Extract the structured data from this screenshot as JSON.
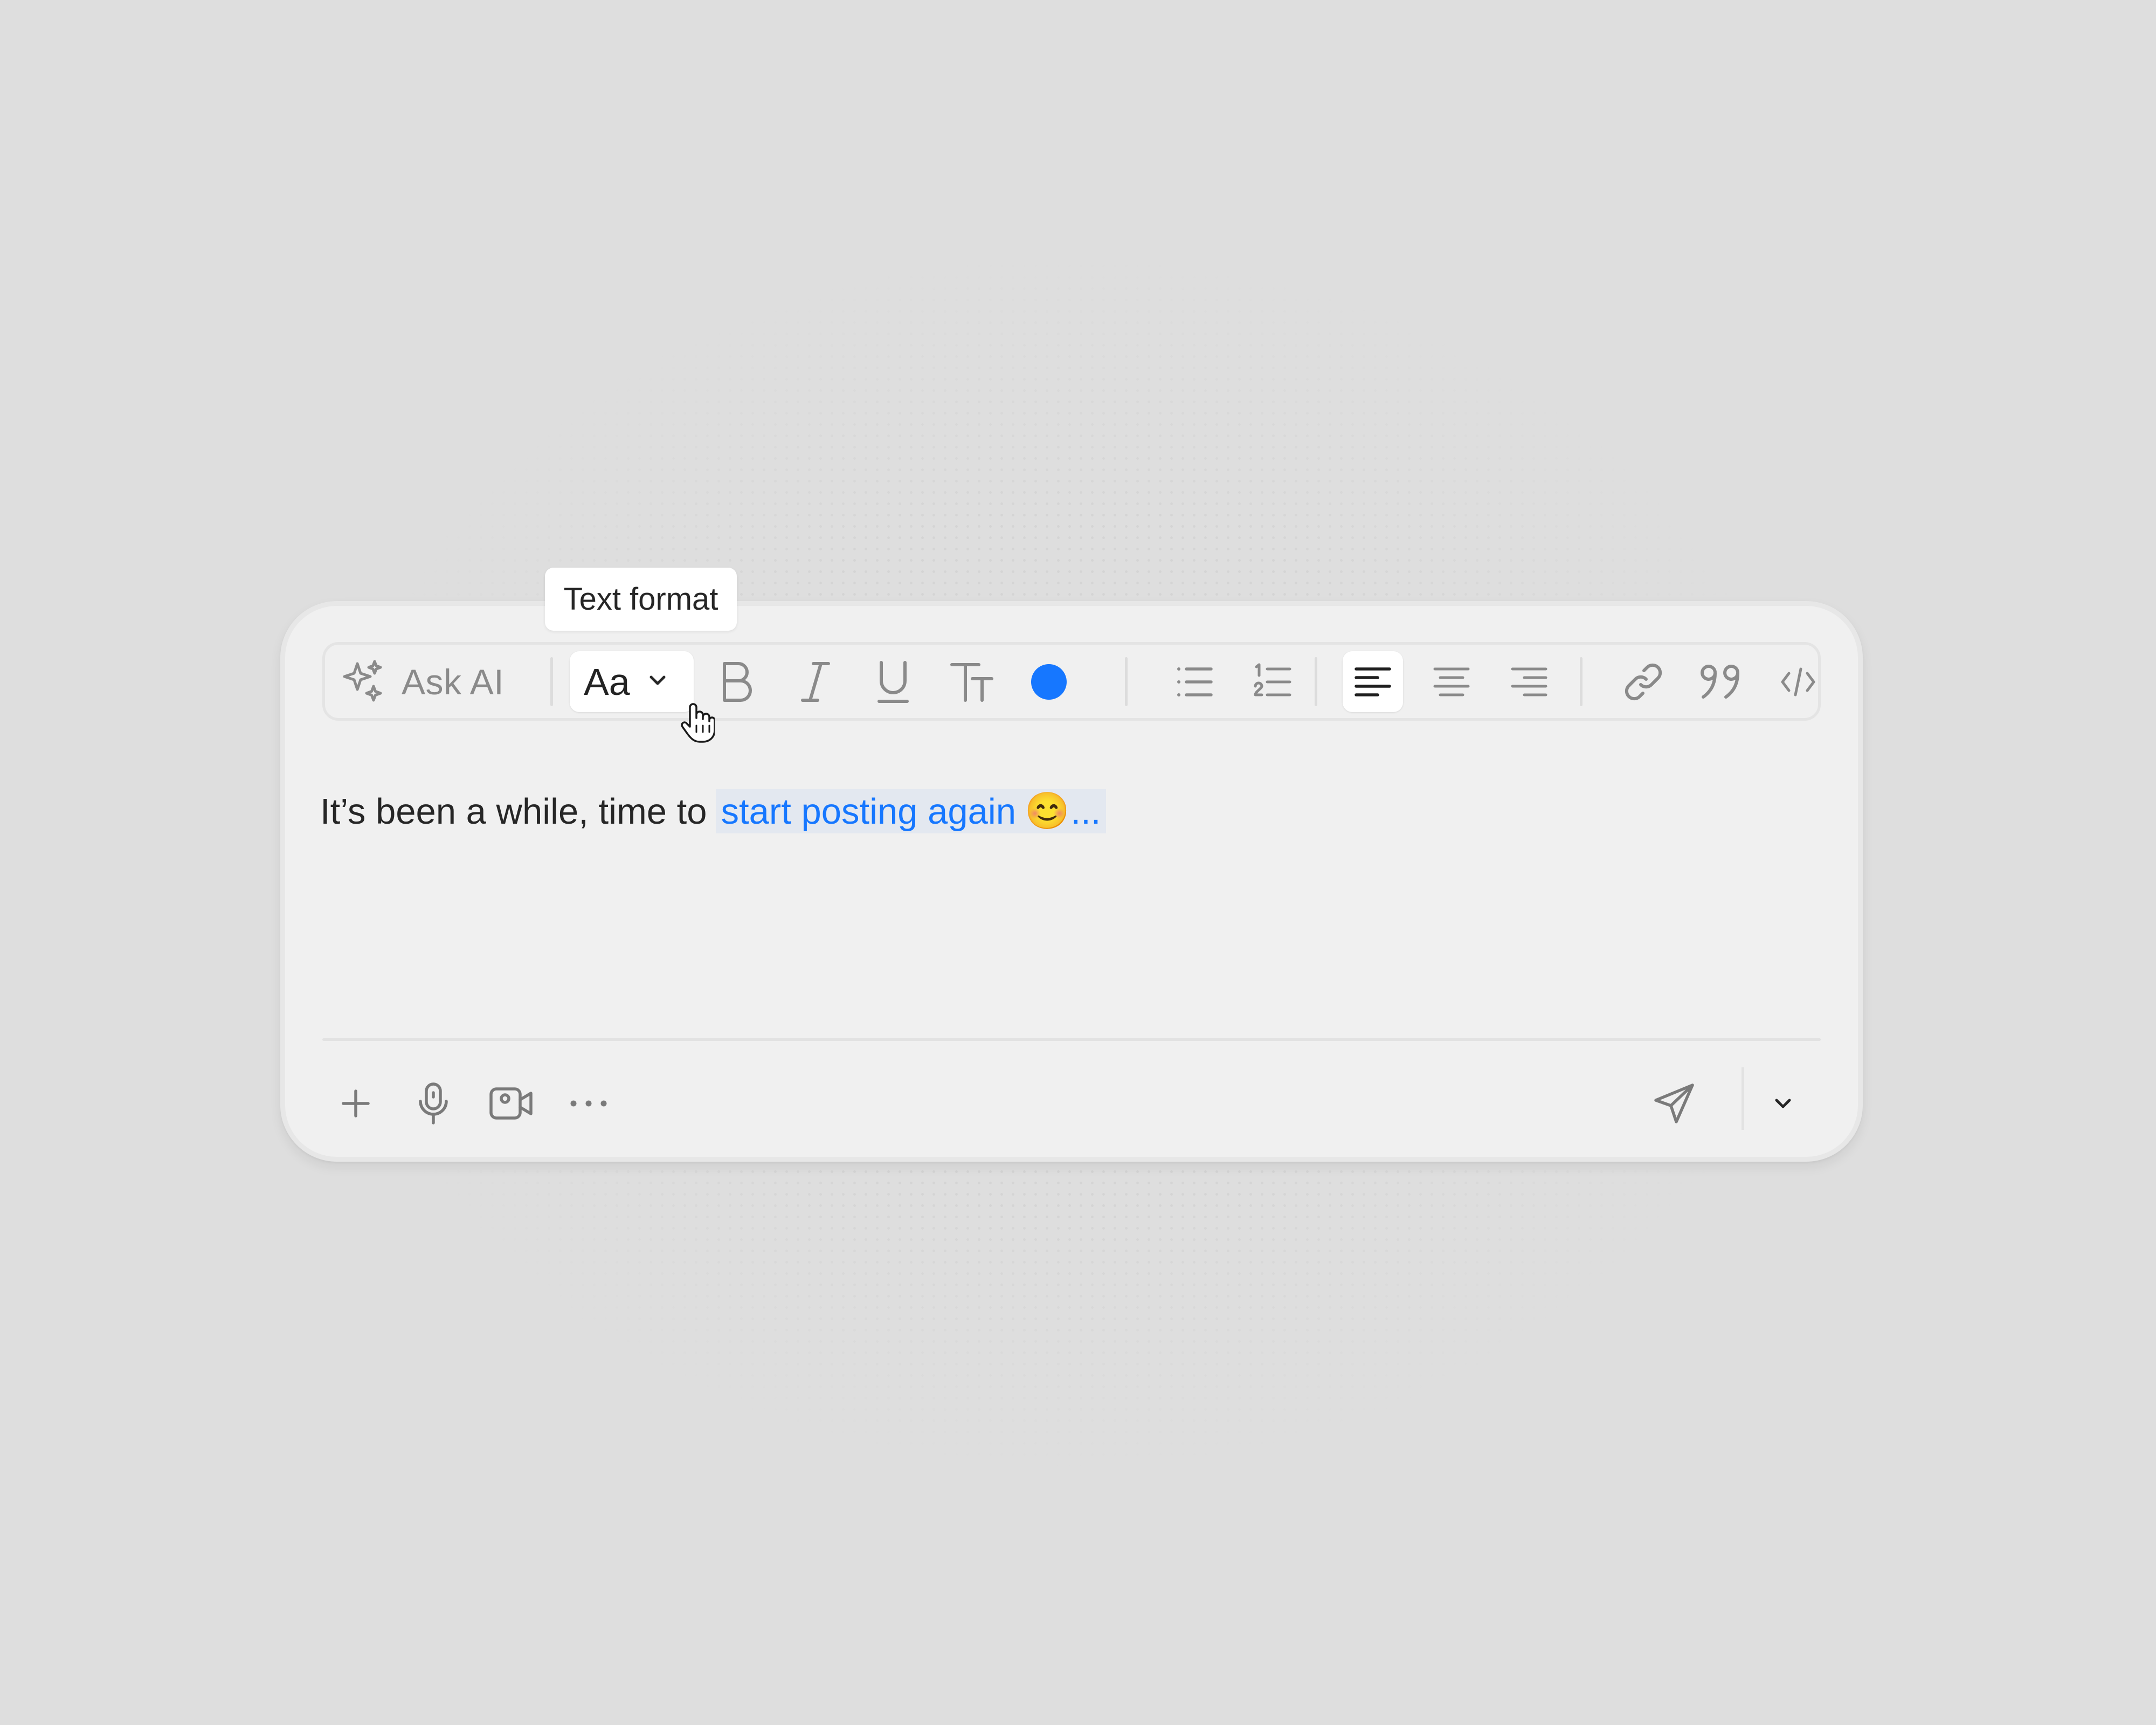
{
  "tooltip": {
    "text": "Text format"
  },
  "toolbar": {
    "ask_ai_label": "Ask AI",
    "format_select_value": "Aa",
    "text_color": "#1677ff",
    "icons": {
      "ask_ai": "sparkles-icon",
      "format_dropdown": "chevron-down-icon",
      "bold": "bold-icon",
      "italic": "italic-icon",
      "underline": "underline-icon",
      "text_size": "text-size-icon",
      "color": "color-dot-icon",
      "bullet_list": "bullet-list-icon",
      "numbered_list": "numbered-list-icon",
      "align_left": "align-left-icon",
      "align_center": "align-center-icon",
      "align_right": "align-right-icon",
      "link": "link-icon",
      "quote": "quote-icon",
      "code": "code-icon"
    },
    "active_alignment": "left"
  },
  "editor": {
    "text_plain": "It’s been a while, time to",
    "text_highlighted": "start posting again",
    "emoji": "😊",
    "trailing": "...",
    "highlight_color": "#1677ff"
  },
  "footer": {
    "icons": {
      "add": "plus-icon",
      "voice": "microphone-icon",
      "video": "video-icon",
      "more": "more-horizontal-icon",
      "send": "send-icon",
      "send_options": "chevron-down-icon"
    }
  }
}
